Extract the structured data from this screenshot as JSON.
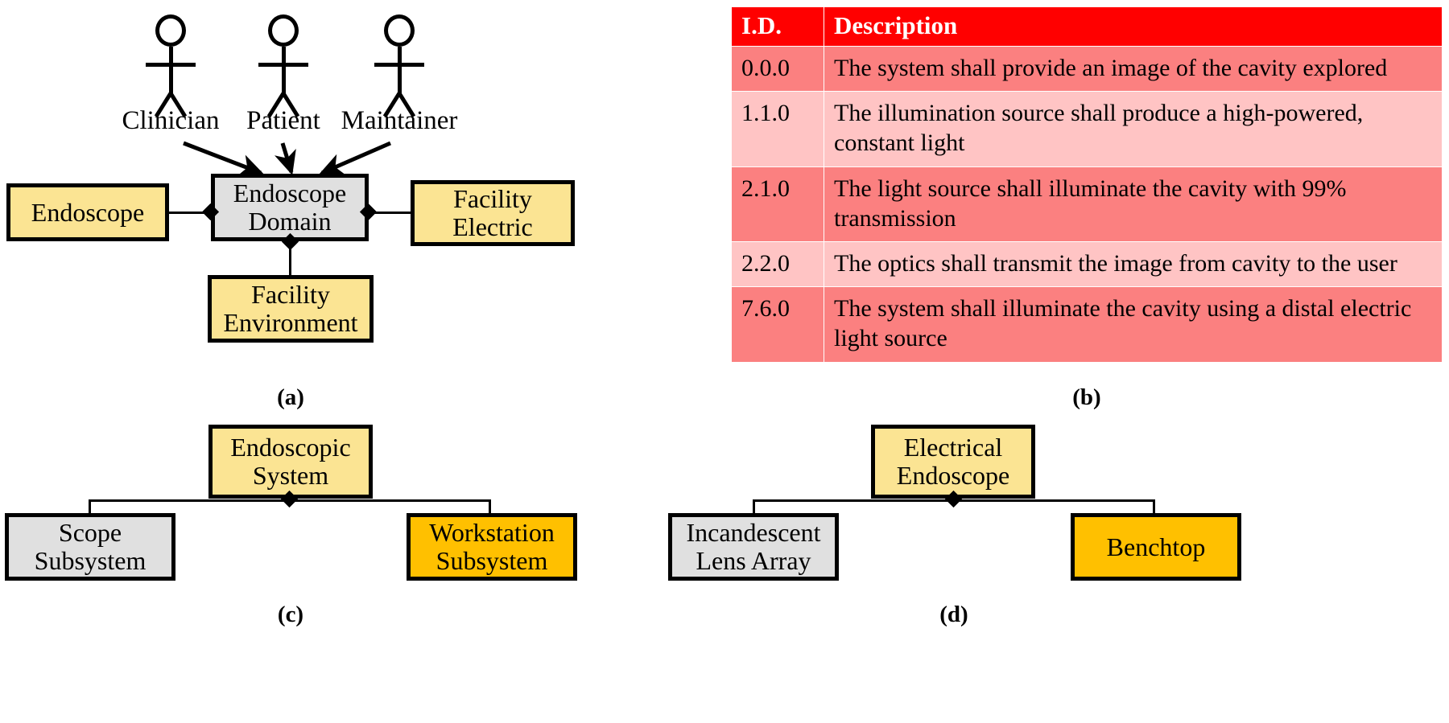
{
  "figure": {
    "panels": [
      {
        "id": "a",
        "caption": "(a)",
        "actors": [
          {
            "label": "Clinician"
          },
          {
            "label": "Patient"
          },
          {
            "label": "Maintainer"
          }
        ],
        "nodes": [
          {
            "label": "Endoscope",
            "color": "#FBE493"
          },
          {
            "label": "Endoscope\nDomain",
            "color": "#E0E0E0"
          },
          {
            "label": "Facility\nElectric",
            "color": "#FBE493"
          },
          {
            "label": "Facility\nEnvironment",
            "color": "#FBE493"
          }
        ]
      },
      {
        "id": "b",
        "caption": "(b)"
      },
      {
        "id": "c",
        "caption": "(c)",
        "nodes": [
          {
            "label": "Endoscopic\nSystem",
            "color": "#FBE493"
          },
          {
            "label": "Scope\nSubsystem",
            "color": "#E0E0E0"
          },
          {
            "label": "Workstation\nSubsystem",
            "color": "#FFC000"
          }
        ]
      },
      {
        "id": "d",
        "caption": "(d)",
        "nodes": [
          {
            "label": "Electrical\nEndoscope",
            "color": "#FBE493"
          },
          {
            "label": "Incandescent\nLens Array",
            "color": "#E0E0E0"
          },
          {
            "label": "Benchtop",
            "color": "#FFC000"
          }
        ]
      }
    ]
  },
  "table": {
    "header_color": "#FF0000",
    "row_color_dark": "#FB8080",
    "row_color_light": "#FFC4C4",
    "columns": [
      "I.D.",
      "Description"
    ],
    "rows": [
      {
        "id": "0.0.0",
        "description": "The system shall provide an image of the cavity explored"
      },
      {
        "id": "1.1.0",
        "description": "The illumination source shall produce a high-powered, constant light"
      },
      {
        "id": "2.1.0",
        "description": "The light source shall illuminate the cavity with 99% transmission"
      },
      {
        "id": "2.2.0",
        "description": "The optics shall transmit the image from cavity to the user"
      },
      {
        "id": "7.6.0",
        "description": "The system shall illuminate the cavity using a distal electric light source"
      }
    ]
  },
  "panel_a": {
    "actor_1_label": "Clinician",
    "actor_2_label": "Patient",
    "actor_3_label": "Maintainer",
    "node_endoscope": "Endoscope",
    "node_domain": "Endoscope\nDomain",
    "node_facility_electric": "Facility\nElectric",
    "node_facility_environment": "Facility\nEnvironment",
    "caption": "(a)"
  },
  "panel_b": {
    "caption": "(b)"
  },
  "panel_c": {
    "node_parent": "Endoscopic\nSystem",
    "node_left": "Scope\nSubsystem",
    "node_right": "Workstation\nSubsystem",
    "caption": "(c)"
  },
  "panel_d": {
    "node_parent": "Electrical\nEndoscope",
    "node_left": "Incandescent\nLens Array",
    "node_right": "Benchtop",
    "caption": "(d)"
  }
}
